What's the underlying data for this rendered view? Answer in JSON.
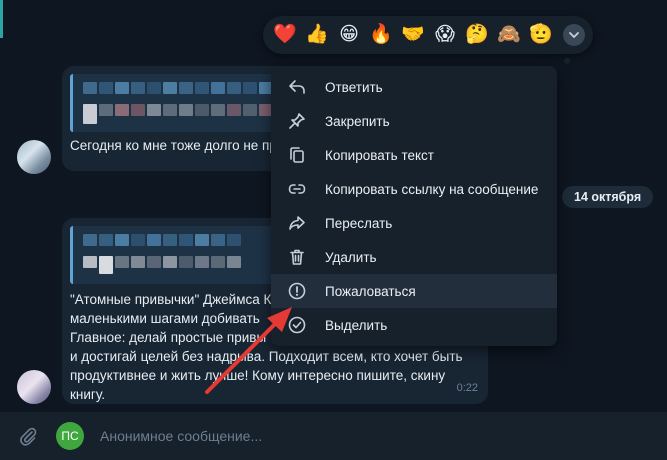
{
  "reactions": [
    "❤️",
    "👍",
    "😁",
    "🔥",
    "🤝",
    "😱",
    "🤔",
    "🙈",
    "🫡"
  ],
  "messages": [
    {
      "text": "Сегодня ко мне тоже долго не пр"
    },
    {
      "text": "\"Атомные привычки\" Джеймса К\nмаленькими шагами добивать\nГлавное: делай простые привы\nи достигай целей без надрыва. Подходит всем, кто хочет быть\nпродуктивнее и жить лучше! Кому интересно пишите, скину\nкнигу.",
      "time": "0:22"
    }
  ],
  "date_separator": "14 октября",
  "context_menu": {
    "items": [
      {
        "label": "Ответить",
        "icon": "reply-icon"
      },
      {
        "label": "Закрепить",
        "icon": "pin-icon"
      },
      {
        "label": "Копировать текст",
        "icon": "copy-icon"
      },
      {
        "label": "Копировать ссылку на сообщение",
        "icon": "link-icon"
      },
      {
        "label": "Переслать",
        "icon": "forward-icon"
      },
      {
        "label": "Удалить",
        "icon": "trash-icon"
      },
      {
        "label": "Пожаловаться",
        "icon": "report-icon"
      },
      {
        "label": "Выделить",
        "icon": "select-icon"
      }
    ],
    "highlighted": "Пожаловаться"
  },
  "composer": {
    "sender_initials": "ПС",
    "placeholder": "Анонимное сообщение..."
  },
  "colors": {
    "background": "#0e1621",
    "bubble": "#182533",
    "menu": "#17212b",
    "accent": "#5fa4d6",
    "arrow": "#e53935",
    "sender_badge": "#3ea83f"
  }
}
